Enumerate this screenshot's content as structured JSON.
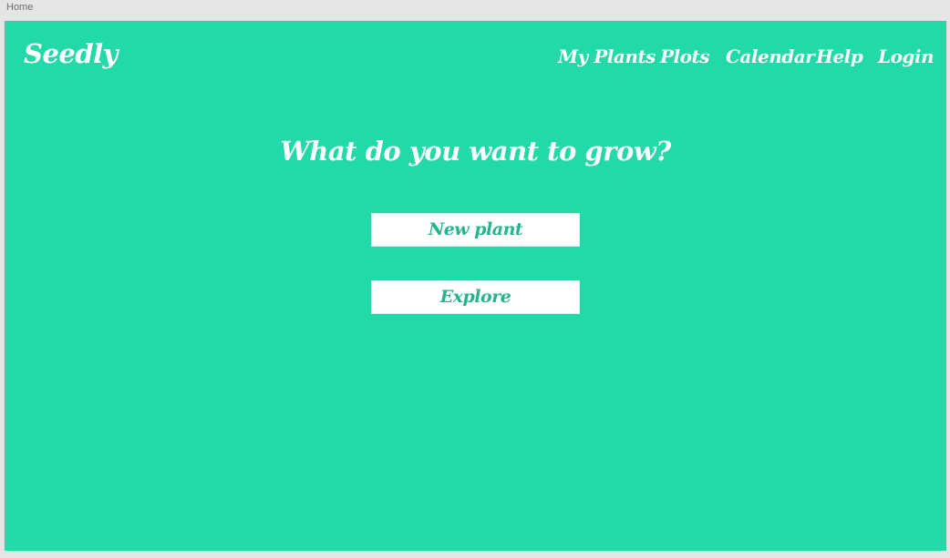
{
  "artboard_label": "Home",
  "header": {
    "brand": "Seedly",
    "nav": [
      {
        "label": "My Plants"
      },
      {
        "label": "Plots"
      },
      {
        "label": "Calendar"
      },
      {
        "label": "Help"
      },
      {
        "label": "Login"
      }
    ]
  },
  "main": {
    "headline": "What do you want to grow?",
    "buttons": [
      {
        "label": "New plant"
      },
      {
        "label": "Explore"
      }
    ]
  },
  "colors": {
    "background": "#22d9a8",
    "button_text": "#26b48f",
    "text": "#ffffff"
  }
}
